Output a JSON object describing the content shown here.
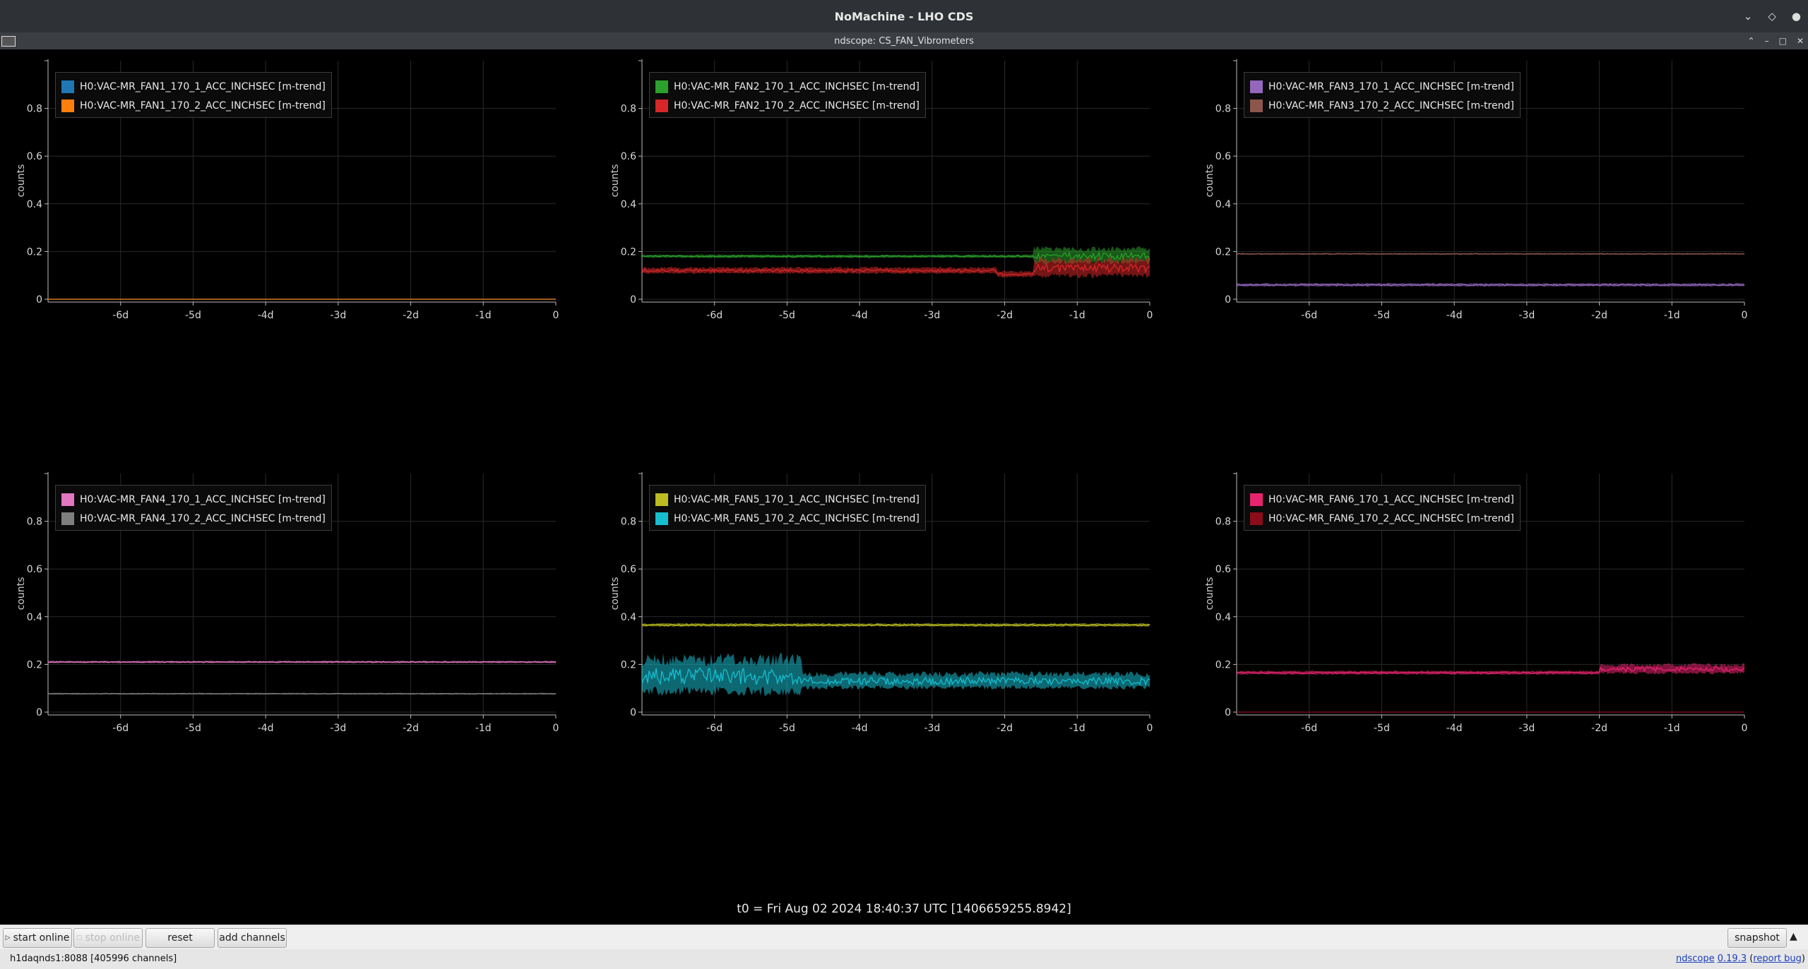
{
  "window": {
    "title": "NoMachine - LHO CDS",
    "subtitle": "ndscope: CS_FAN_Vibrometers"
  },
  "colors": {
    "background": "#000000",
    "grid": "#2a2a2a",
    "axis": "#bbbbbb"
  },
  "chart_data": [
    {
      "type": "line",
      "ylabel": "counts",
      "ylim": [
        0,
        1
      ],
      "yticks": [
        "0",
        "0.2",
        "0.4",
        "0.6",
        "0.8"
      ],
      "xticks": [
        "-6d",
        "-5d",
        "-4d",
        "-3d",
        "-2d",
        "-1d",
        "0"
      ],
      "grid": true,
      "legend_position": "top-left",
      "series": [
        {
          "name": "H0:VAC-MR_FAN1_170_1_ACC_INCHSEC [m-trend]",
          "color": "#1f77b4",
          "level": 0.0,
          "noise": 0.0
        },
        {
          "name": "H0:VAC-MR_FAN1_170_2_ACC_INCHSEC [m-trend]",
          "color": "#ff7f0e",
          "level": 0.0,
          "noise": 0.0
        }
      ]
    },
    {
      "type": "line",
      "ylabel": "counts",
      "ylim": [
        0,
        1
      ],
      "yticks": [
        "0",
        "0.2",
        "0.4",
        "0.6",
        "0.8"
      ],
      "xticks": [
        "-6d",
        "-5d",
        "-4d",
        "-3d",
        "-2d",
        "-1d",
        "0"
      ],
      "grid": true,
      "legend_position": "top-left",
      "series": [
        {
          "name": "H0:VAC-MR_FAN2_170_1_ACC_INCHSEC [m-trend]",
          "color": "#2ca02c",
          "level": 0.18,
          "noise": 0.006
        },
        {
          "name": "H0:VAC-MR_FAN2_170_2_ACC_INCHSEC [m-trend]",
          "color": "#d62728",
          "level": 0.12,
          "noise": 0.012
        }
      ]
    },
    {
      "type": "line",
      "ylabel": "counts",
      "ylim": [
        0,
        1
      ],
      "yticks": [
        "0",
        "0.2",
        "0.4",
        "0.6",
        "0.8"
      ],
      "xticks": [
        "-6d",
        "-5d",
        "-4d",
        "-3d",
        "-2d",
        "-1d",
        "0"
      ],
      "grid": true,
      "legend_position": "top-left",
      "series": [
        {
          "name": "H0:VAC-MR_FAN3_170_1_ACC_INCHSEC [m-trend]",
          "color": "#9467bd",
          "level": 0.06,
          "noise": 0.006
        },
        {
          "name": "H0:VAC-MR_FAN3_170_2_ACC_INCHSEC [m-trend]",
          "color": "#8c564b",
          "level": 0.19,
          "noise": 0.003
        }
      ]
    },
    {
      "type": "line",
      "ylabel": "counts",
      "ylim": [
        0,
        1
      ],
      "yticks": [
        "0",
        "0.2",
        "0.4",
        "0.6",
        "0.8"
      ],
      "xticks": [
        "-6d",
        "-5d",
        "-4d",
        "-3d",
        "-2d",
        "-1d",
        "0"
      ],
      "grid": true,
      "legend_position": "top-left",
      "series": [
        {
          "name": "H0:VAC-MR_FAN4_170_1_ACC_INCHSEC [m-trend]",
          "color": "#e377c2",
          "level": 0.21,
          "noise": 0.004
        },
        {
          "name": "H0:VAC-MR_FAN4_170_2_ACC_INCHSEC [m-trend]",
          "color": "#7f7f7f",
          "level": 0.077,
          "noise": 0.003
        }
      ]
    },
    {
      "type": "line",
      "ylabel": "counts",
      "ylim": [
        0,
        1
      ],
      "yticks": [
        "0",
        "0.2",
        "0.4",
        "0.6",
        "0.8"
      ],
      "xticks": [
        "-6d",
        "-5d",
        "-4d",
        "-3d",
        "-2d",
        "-1d",
        "0"
      ],
      "grid": true,
      "legend_position": "top-left",
      "series": [
        {
          "name": "H0:VAC-MR_FAN5_170_1_ACC_INCHSEC [m-trend]",
          "color": "#bcbd22",
          "level": 0.365,
          "noise": 0.006
        },
        {
          "name": "H0:VAC-MR_FAN5_170_2_ACC_INCHSEC [m-trend]",
          "color": "#17becf",
          "level": 0.13,
          "noise": 0.03
        }
      ]
    },
    {
      "type": "line",
      "ylabel": "counts",
      "ylim": [
        0,
        1
      ],
      "yticks": [
        "0",
        "0.2",
        "0.4",
        "0.6",
        "0.8"
      ],
      "xticks": [
        "-6d",
        "-5d",
        "-4d",
        "-3d",
        "-2d",
        "-1d",
        "0"
      ],
      "grid": true,
      "legend_position": "top-left",
      "series": [
        {
          "name": "H0:VAC-MR_FAN6_170_1_ACC_INCHSEC [m-trend]",
          "color": "#e9246f",
          "level": 0.165,
          "noise": 0.007
        },
        {
          "name": "H0:VAC-MR_FAN6_170_2_ACC_INCHSEC [m-trend]",
          "color": "#8b0d1a",
          "level": 0.0,
          "noise": 0.0
        }
      ]
    }
  ],
  "t0_text": "t0 = Fri Aug 02 2024 18:40:37 UTC [1406659255.8942]",
  "toolbar": {
    "start_online": "start online",
    "stop_online": "stop online",
    "reset": "reset",
    "add_channels": "add channels",
    "snapshot": "snapshot"
  },
  "status": {
    "server": "h1daqnds1:8088",
    "channels": "[405996 channels]",
    "app_name": "ndscope",
    "version": "0.19.3",
    "report_bug": "report bug"
  }
}
